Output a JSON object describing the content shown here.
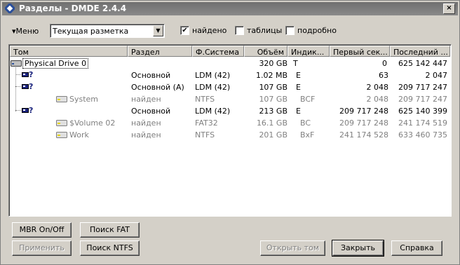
{
  "window": {
    "title": "Разделы - DMDE 2.4.4",
    "close_label": "×"
  },
  "toolbar": {
    "menu_label": "Меню",
    "layout_select": "Текущая разметка",
    "checkboxes": [
      {
        "label": "найдено",
        "checked": true
      },
      {
        "label": "таблицы",
        "checked": false
      },
      {
        "label": "подробно",
        "checked": false
      }
    ]
  },
  "table": {
    "columns": [
      "Том",
      "Раздел",
      "Ф.Система",
      "Объём",
      "Индик...",
      "Первый сек...",
      "Последний ..."
    ],
    "rows": [
      {
        "name": "Physical Drive 0",
        "part": "",
        "fs": "",
        "size": "320 GB",
        "ind": "T",
        "first": "0",
        "last": "625 142 447",
        "grey": false
      },
      {
        "name": "",
        "part": "Основной",
        "fs": "LDM (42)",
        "size": "1.02 MB",
        "ind": "E",
        "first": "63",
        "last": "2 047",
        "grey": false
      },
      {
        "name": "",
        "part": "Основной (A)",
        "fs": "LDM (42)",
        "size": "107 GB",
        "ind": "E",
        "first": "2 048",
        "last": "209 717 247",
        "grey": false
      },
      {
        "name": "System",
        "part": "найден",
        "fs": "NTFS",
        "size": "107 GB",
        "ind": "BCF",
        "first": "2 048",
        "last": "209 717 247",
        "grey": true
      },
      {
        "name": "",
        "part": "Основной",
        "fs": "LDM (42)",
        "size": "213 GB",
        "ind": "E",
        "first": "209 717 248",
        "last": "625 140 399",
        "grey": false
      },
      {
        "name": "$Volume 02",
        "part": "найден",
        "fs": "FAT32",
        "size": "16.1 GB",
        "ind": "BC",
        "first": "209 717 248",
        "last": "241 174 519",
        "grey": true
      },
      {
        "name": "Work",
        "part": "найден",
        "fs": "NTFS",
        "size": "201 GB",
        "ind": "BxF",
        "first": "241 174 528",
        "last": "633 460 735",
        "grey": true
      }
    ]
  },
  "buttons": {
    "mbr": "MBR On/Off",
    "find_fat": "Поиск FAT",
    "apply": "Применить",
    "find_ntfs": "Поиск NTFS",
    "open_volume": "Открыть том",
    "close": "Закрыть",
    "help": "Справка"
  },
  "icons": {
    "unknown_part": "?"
  }
}
